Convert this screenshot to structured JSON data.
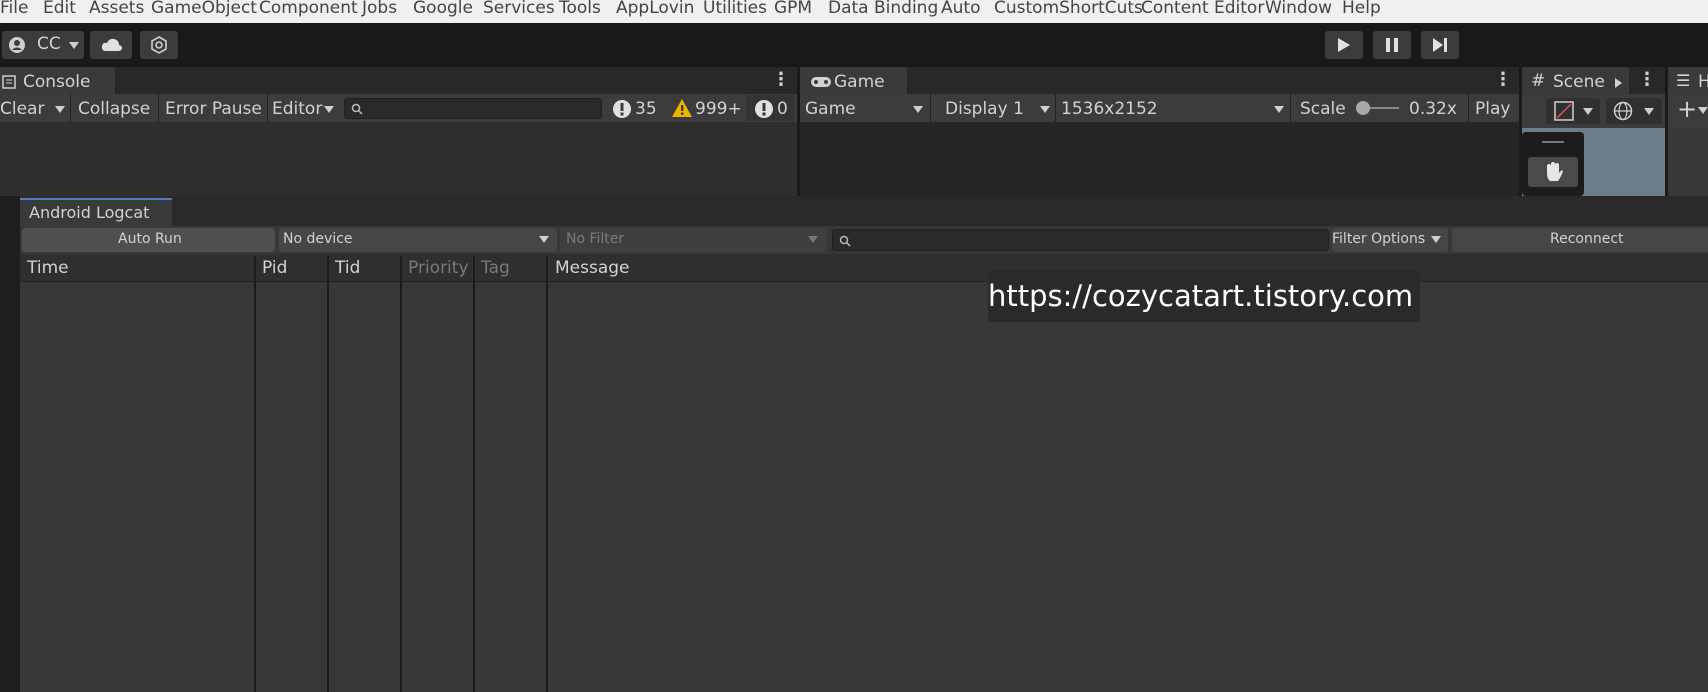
{
  "menu": [
    "File",
    "Edit",
    "Assets",
    "GameObject",
    "Component",
    "Jobs",
    "Google",
    "Services",
    "Tools",
    "AppLovin",
    "Utilities",
    "GPM",
    "Data Binding",
    "Auto",
    "CustomShortCuts",
    "Content Editor",
    "Window",
    "Help"
  ],
  "toolbar": {
    "account_label": "CC"
  },
  "console": {
    "tab_title": "Console",
    "clear_label": "Clear",
    "collapse_label": "Collapse",
    "error_pause_label": "Error Pause",
    "editor_label": "Editor",
    "search_value": "",
    "info_count": "35",
    "warning_count": "999+",
    "error_count": "0"
  },
  "game": {
    "tab_title": "Game",
    "mode_label": "Game",
    "display_label": "Display 1",
    "resolution_label": "1536x2152",
    "scale_label": "Scale",
    "scale_value": "0.32x",
    "play_label": "Play"
  },
  "scene": {
    "tab_title": "Scene"
  },
  "hierarchy": {
    "tab_title": "H"
  },
  "logcat": {
    "tab_title": "Android Logcat",
    "auto_run_label": "Auto Run",
    "device_label": "No device",
    "filter_label": "No Filter",
    "search_value": "",
    "filter_options_label": "Filter Options",
    "reconnect_label": "Reconnect",
    "columns": [
      "Time",
      "Pid",
      "Tid",
      "Priority",
      "Tag",
      "Message"
    ]
  },
  "watermark": "https://cozycatart.tistory.com",
  "colors": {
    "accent": "#4a7fc0",
    "warning": "#f0b400",
    "panel": "#383838"
  }
}
